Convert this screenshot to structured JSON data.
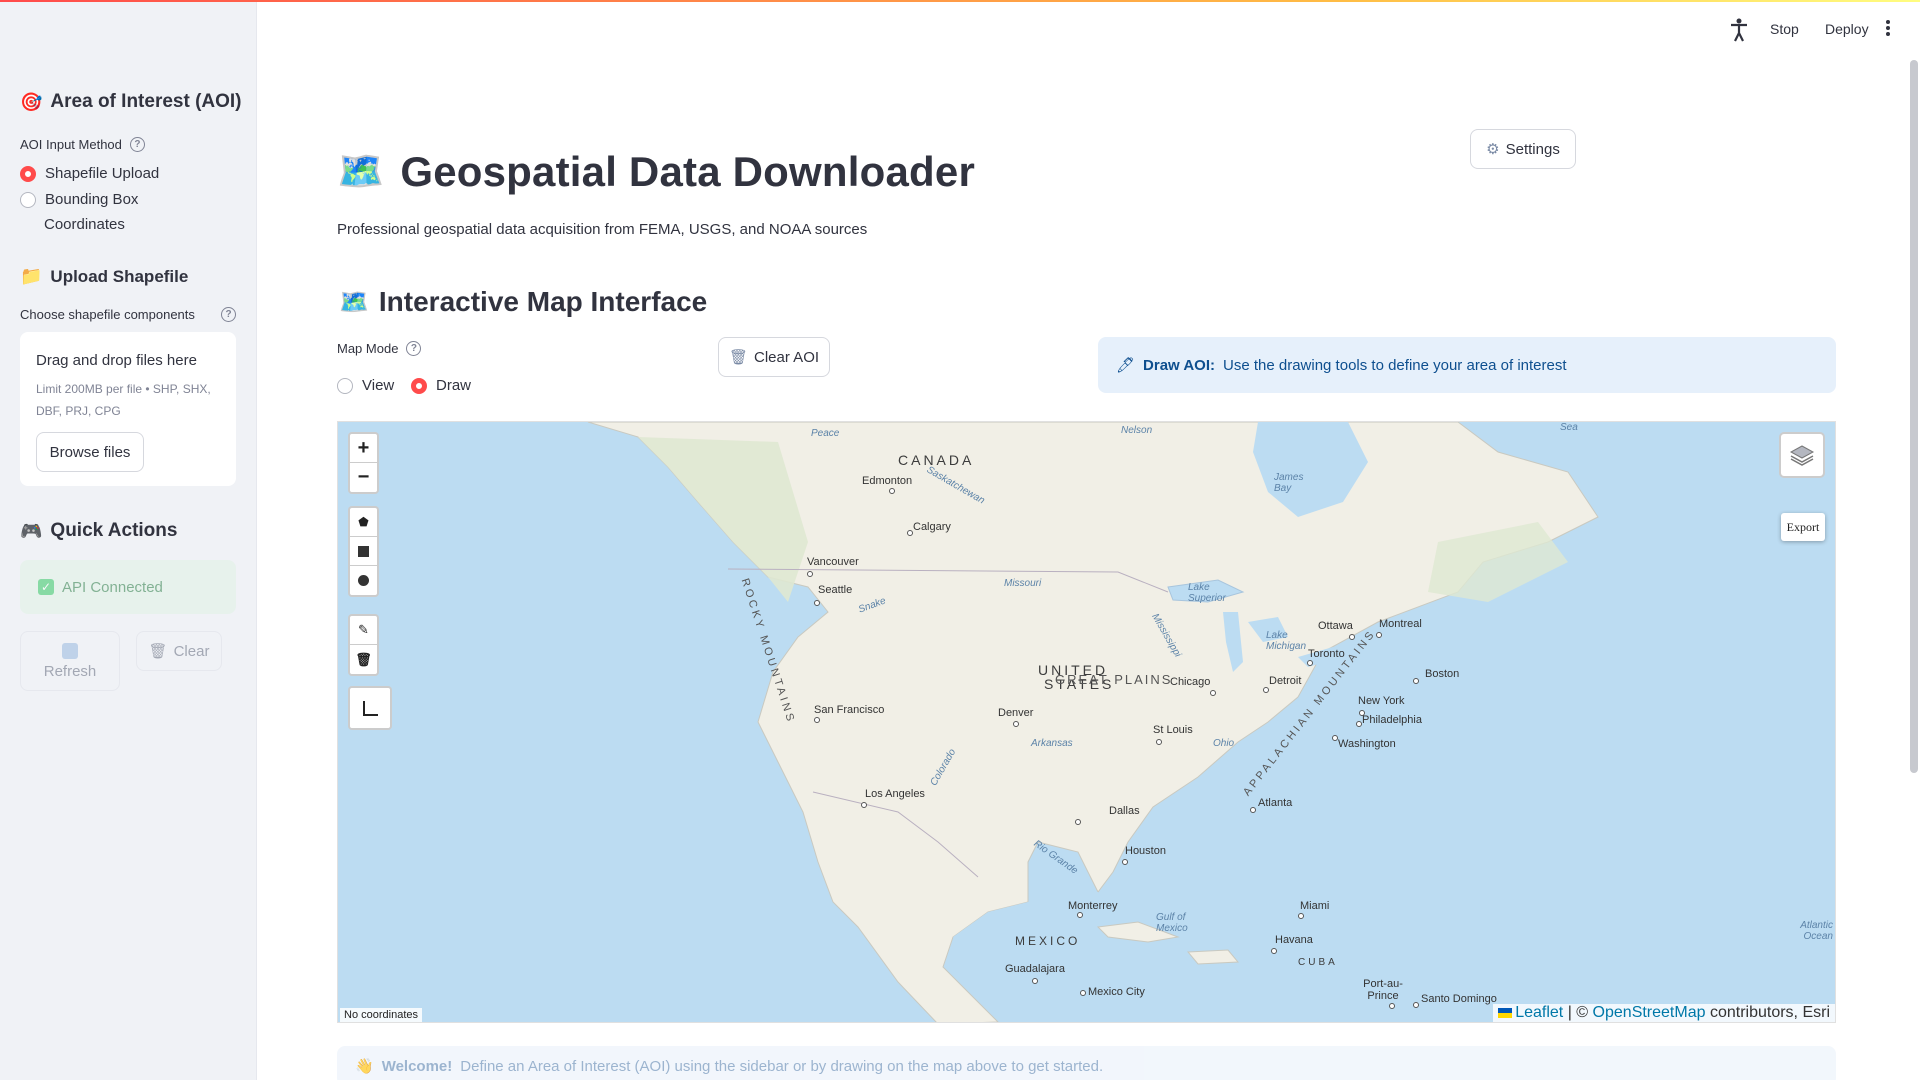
{
  "header": {
    "stop_label": "Stop",
    "deploy_label": "Deploy"
  },
  "sidebar": {
    "aoi_heading": "Area of Interest (AOI)",
    "aoi_heading_icon": "target-emoji",
    "aoi_input_label": "AOI Input Method",
    "aoi_options": [
      "Shapefile Upload",
      "Bounding Box",
      "Coordinates"
    ],
    "aoi_selected": "Shapefile Upload",
    "upload_heading": "Upload Shapefile",
    "upload_heading_icon": "folder-emoji",
    "choose_label": "Choose shapefile components",
    "drop_title": "Drag and drop files here",
    "drop_limit": "Limit 200MB per file • SHP, SHX, DBF, PRJ, CPG",
    "browse_label": "Browse files",
    "quick_heading": "Quick Actions",
    "quick_heading_icon": "game-controller-emoji",
    "api_status": "API Connected",
    "refresh_label": "Refresh",
    "clear_label": "Clear"
  },
  "main": {
    "settings_label": "Settings",
    "title": "Geospatial Data Downloader",
    "subtitle": "Professional geospatial data acquisition from FEMA, USGS, and NOAA sources",
    "section_title": "Interactive Map Interface",
    "map_mode_label": "Map Mode",
    "map_mode_options": [
      "View",
      "Draw"
    ],
    "map_mode_selected": "Draw",
    "clear_aoi_label": "Clear AOI",
    "info_bold": "Draw AOI:",
    "info_text": "Use the drawing tools to define your area of interest",
    "welcome_bold": "Welcome!",
    "welcome_text": "Define an Area of Interest (AOI) using the sidebar or by drawing on the map above to get started."
  },
  "map": {
    "zoom_in": "+",
    "zoom_out": "−",
    "export_label": "Export",
    "coords_text": "No coordinates",
    "attribution_leaflet": "Leaflet",
    "attribution_sep": "| ©",
    "attribution_osm": "OpenStreetMap",
    "attribution_rest": "contributors, Esri",
    "labels": {
      "canada": "CANADA",
      "us1": "UNITED",
      "us2": "STATES",
      "mexico": "MEXICO",
      "cuba": "CUBA",
      "great_plains": "GREAT PLAINS",
      "rocky": "ROCKY MOUNTAINS",
      "appalachian": "APPALACHIAN MOUNTAINS",
      "gulf": "Gulf of Mexico",
      "atlantic": "Atlantic Ocean",
      "james_bay": "James Bay",
      "lake_superior": "Lake Superior",
      "lake_michigan": "Lake Michigan",
      "edmonton": "Edmonton",
      "calgary": "Calgary",
      "vancouver": "Vancouver",
      "seattle": "Seattle",
      "san_francisco": "San Francisco",
      "los_angeles": "Los Angeles",
      "denver": "Denver",
      "dallas": "Dallas",
      "houston": "Houston",
      "st_louis": "St Louis",
      "chicago": "Chicago",
      "detroit": "Detroit",
      "toronto": "Toronto",
      "ottawa": "Ottawa",
      "montreal": "Montreal",
      "boston": "Boston",
      "new_york": "New York",
      "philadelphia": "Philadelphia",
      "washington": "Washington",
      "atlanta": "Atlanta",
      "miami": "Miami",
      "havana": "Havana",
      "monterrey": "Monterrey",
      "guadalajara": "Guadalajara",
      "mexico_city": "Mexico City",
      "port_au_prince": "Port-au-Prince",
      "santo_domingo": "Santo Domingo",
      "peace": "Peace",
      "nelson": "Nelson",
      "missouri": "Missouri",
      "arkansas": "Arkansas",
      "rio_grande": "Rio Grande",
      "colorado": "Colorado",
      "ohio": "Ohio",
      "saskatchewan": "Saskatchewan",
      "snake": "Snake",
      "mississippi": "Mississippi",
      "sea": "Sea"
    }
  },
  "colors": {
    "accent": "#ff4b4b",
    "sidebar_bg": "#f0f2f6",
    "info_bg": "#e6f0fb",
    "land": "#f1efe6",
    "water": "#bcdcf2"
  }
}
